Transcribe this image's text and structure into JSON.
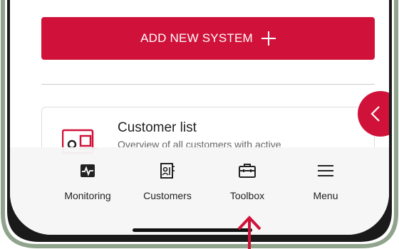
{
  "colors": {
    "accent": "#d0123a",
    "tabbar_bg": "#f6f6f6",
    "bezel": "#1a1a1a"
  },
  "add_system": {
    "label": "ADD NEW SYSTEM"
  },
  "card": {
    "title": "Customer list",
    "subtitle": "Overview of all customers with active"
  },
  "tabs": [
    {
      "label": "Monitoring",
      "icon": "monitoring-icon"
    },
    {
      "label": "Customers",
      "icon": "customers-icon"
    },
    {
      "label": "Toolbox",
      "icon": "toolbox-icon"
    },
    {
      "label": "Menu",
      "icon": "menu-icon"
    }
  ],
  "annotation": {
    "icon": "up-arrow-icon"
  }
}
